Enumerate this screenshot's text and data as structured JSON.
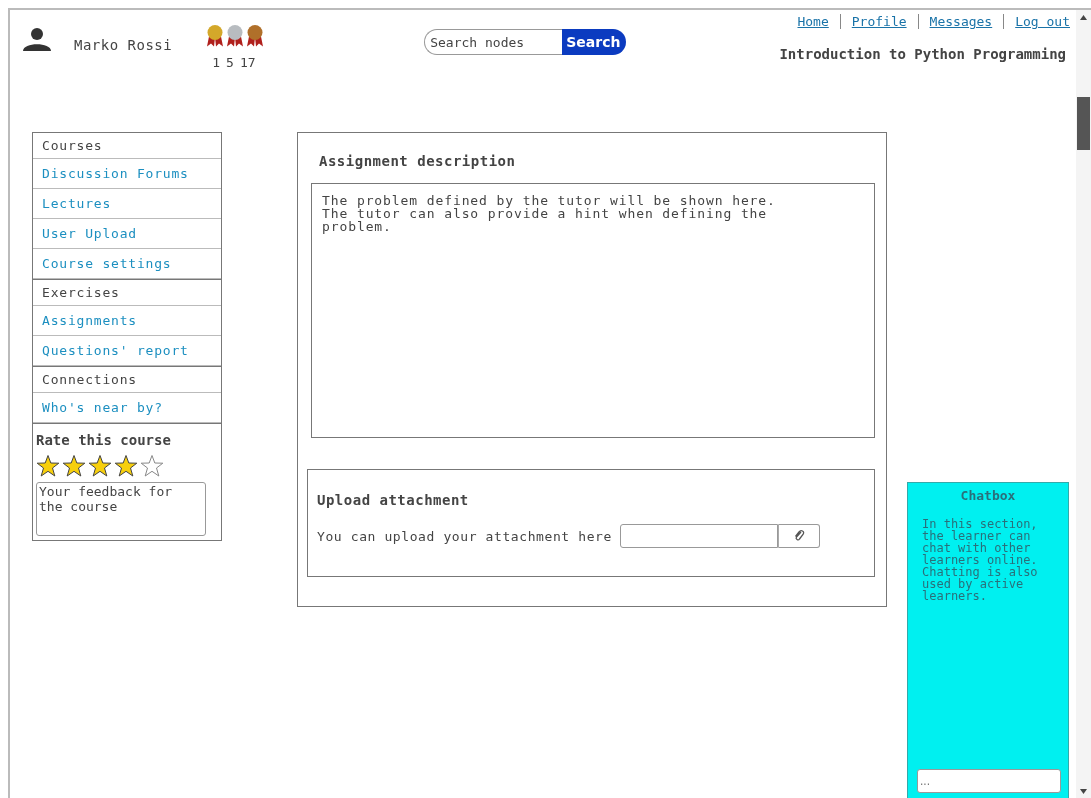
{
  "user": {
    "name": "Marko Rossi"
  },
  "medals": [
    {
      "color": "#d4a82a",
      "count": "1"
    },
    {
      "color": "#b8bcc0",
      "count": "5"
    },
    {
      "color": "#b0702a",
      "count": "17"
    }
  ],
  "search": {
    "placeholder": "Search nodes",
    "button": "Search"
  },
  "nav_links": [
    "Home",
    "Profile",
    "Messages",
    "Log out"
  ],
  "course_title": "Introduction to Python Programming",
  "sidebar": {
    "items": [
      {
        "kind": "header",
        "label": "Courses"
      },
      {
        "kind": "link",
        "label": "Discussion Forums"
      },
      {
        "kind": "link",
        "label": "Lectures"
      },
      {
        "kind": "link",
        "label": "User Upload"
      },
      {
        "kind": "link",
        "label": "Course settings"
      },
      {
        "kind": "header",
        "label": "Exercises"
      },
      {
        "kind": "link",
        "label": "Assignments"
      },
      {
        "kind": "link",
        "label": "Questions' report"
      },
      {
        "kind": "header",
        "label": "Connections"
      },
      {
        "kind": "link",
        "label": "Who's near by?"
      }
    ],
    "rating": {
      "title": "Rate this course",
      "stars": 4,
      "feedback_placeholder": "Your feedback for the course"
    }
  },
  "assignment": {
    "title": "Assignment description",
    "text": "The problem defined by the tutor will be shown here. The tutor can also provide a hint when defining the problem."
  },
  "upload": {
    "title": "Upload attachment",
    "label": "You can upload your attachment here"
  },
  "chatbox": {
    "title": "Chatbox",
    "text": "In this section, the learner can chat with other learners online. Chatting is also used by active learners.",
    "input_placeholder": "..."
  }
}
